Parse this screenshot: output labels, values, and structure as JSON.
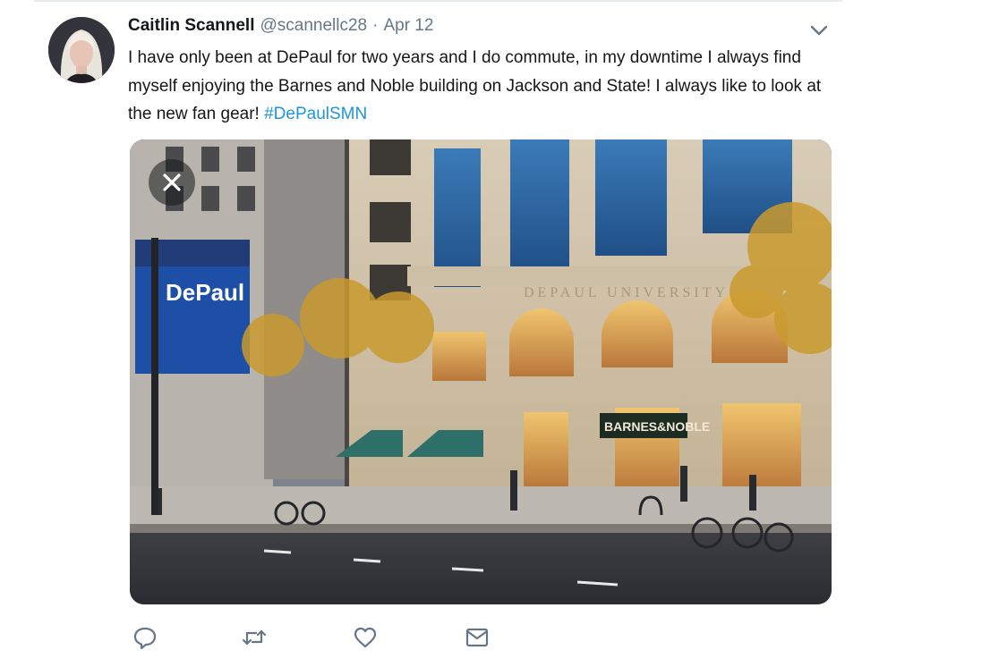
{
  "tweet": {
    "author_name": "Caitlin Scannell",
    "handle": "@scannellc28",
    "separator": "·",
    "date": "Apr 12",
    "text_before_hashtag": "I have only been at DePaul for two years and I do commute, in my downtime I always find myself enjoying the Barnes and Noble building on Jackson and State! I always like to look at the new fan gear! ",
    "hashtag": "#DePaulSMN"
  },
  "photo": {
    "banner_text": "DePaul",
    "facade_text": "DEPAUL   UNIVERSITY",
    "store_sign": "BARNES&NOBLE"
  },
  "icons": {
    "avatar": "avatar",
    "caret": "chevron-down-icon",
    "close": "close-icon",
    "reply": "reply-icon",
    "retweet": "retweet-icon",
    "like": "heart-icon",
    "message": "envelope-icon"
  },
  "colors": {
    "link": "#1b95e0",
    "secondary_text": "#657786",
    "icon": "#657786"
  }
}
